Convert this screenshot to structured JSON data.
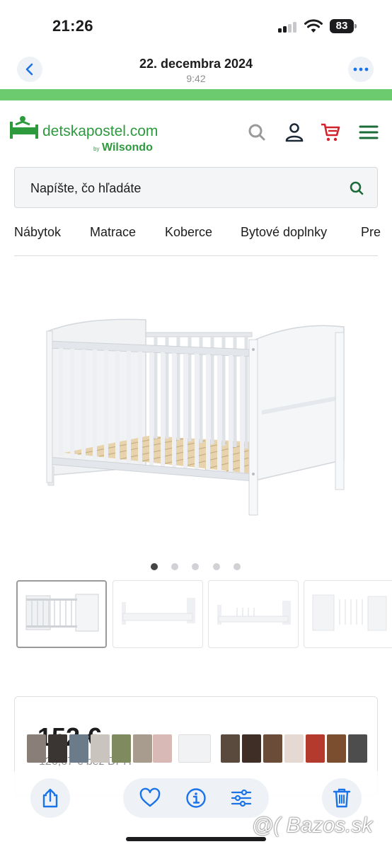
{
  "status_bar": {
    "time": "21:26",
    "battery": "83"
  },
  "photos_header": {
    "date": "22. decembra 2024",
    "time": "9:42"
  },
  "site": {
    "logo_text": "detskapostel.com",
    "logo_by": "by",
    "logo_brand": "Wilsondo",
    "accent": "#2e9a3e",
    "icons": [
      "search-icon",
      "user-icon",
      "cart-icon",
      "menu-icon"
    ]
  },
  "search": {
    "placeholder": "Napíšte, čo hľadáte"
  },
  "nav": {
    "items": [
      "Nábytok",
      "Matrace",
      "Koberce",
      "Bytové doplnky",
      "Pre"
    ]
  },
  "gallery": {
    "dot_count": 5,
    "active_dot": 1
  },
  "price": {
    "main": "152 €",
    "sub": "126,67 € bez DPH"
  },
  "watermark": "@( Bazos.sk"
}
